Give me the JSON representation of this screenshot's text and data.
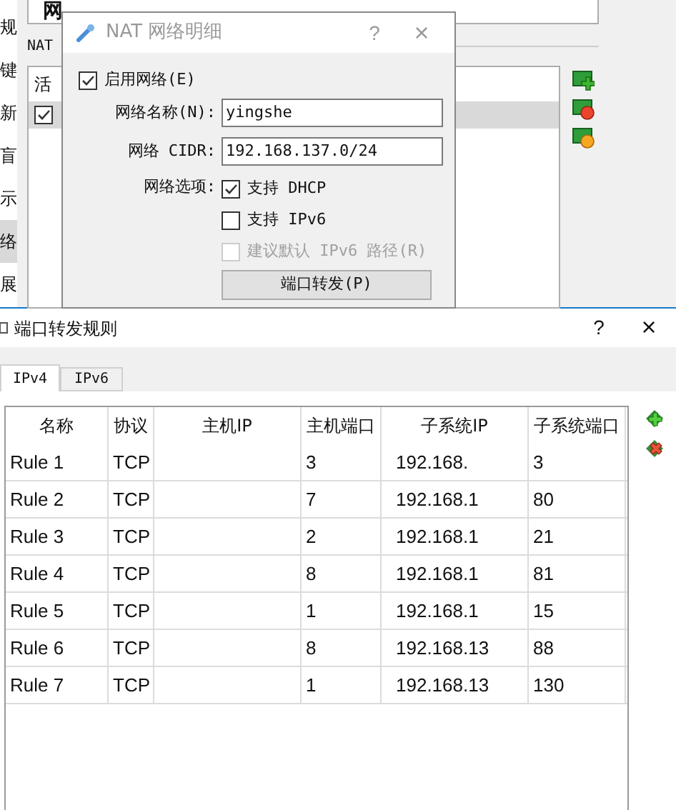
{
  "settings_window": {
    "title": "网",
    "sidebar": [
      {
        "label": "规",
        "selected": false
      },
      {
        "label": "键",
        "selected": false
      },
      {
        "label": "新",
        "selected": false
      },
      {
        "label": "盲",
        "selected": false
      },
      {
        "label": "示",
        "selected": false
      },
      {
        "label": "络",
        "selected": true
      },
      {
        "label": "展",
        "selected": false
      }
    ],
    "nat_label": "NAT",
    "list_header": "活",
    "list_rows": [
      {
        "checked": true,
        "selected": true
      }
    ]
  },
  "nat_dialog": {
    "title": "NAT 网络明细",
    "help": "?",
    "close": "×",
    "enable": {
      "label": "启用网络(E)",
      "checked": true
    },
    "fields": [
      {
        "label": "网络名称(N):",
        "value": "yingshe"
      },
      {
        "label": "网络 CIDR:",
        "value": "192.168.137.0/24"
      }
    ],
    "options_label": "网络选项:",
    "options": [
      {
        "label": "支持 DHCP",
        "checked": true,
        "disabled": false
      },
      {
        "label": "支持 IPv6",
        "checked": false,
        "disabled": false
      },
      {
        "label": "建议默认 IPv6 路径(R)",
        "checked": false,
        "disabled": true
      }
    ],
    "button": "端口转发(P)"
  },
  "rules_window": {
    "title": "端口转发规则",
    "help": "?",
    "close": "×",
    "tabs": [
      {
        "label": "IPv4",
        "selected": true
      },
      {
        "label": "IPv6",
        "selected": false
      }
    ],
    "columns": [
      "名称",
      "协议",
      "主机IP",
      "主机端口",
      "子系统IP",
      "子系统端口"
    ],
    "rows": [
      [
        "Rule 1",
        "TCP",
        "",
        "3",
        "192.168.",
        "3"
      ],
      [
        "Rule 2",
        "TCP",
        "",
        "7",
        "192.168.1",
        "80"
      ],
      [
        "Rule 3",
        "TCP",
        "",
        "2",
        "192.168.1",
        "21"
      ],
      [
        "Rule 4",
        "TCP",
        "",
        "8",
        "192.168.1",
        "81"
      ],
      [
        "Rule 5",
        "TCP",
        "",
        "1",
        "192.168.1",
        "15"
      ],
      [
        "Rule 6",
        "TCP",
        "",
        "8",
        "192.168.13",
        "88"
      ],
      [
        "Rule 7",
        "TCP",
        "",
        "1",
        "192.168.13",
        "130"
      ]
    ]
  }
}
